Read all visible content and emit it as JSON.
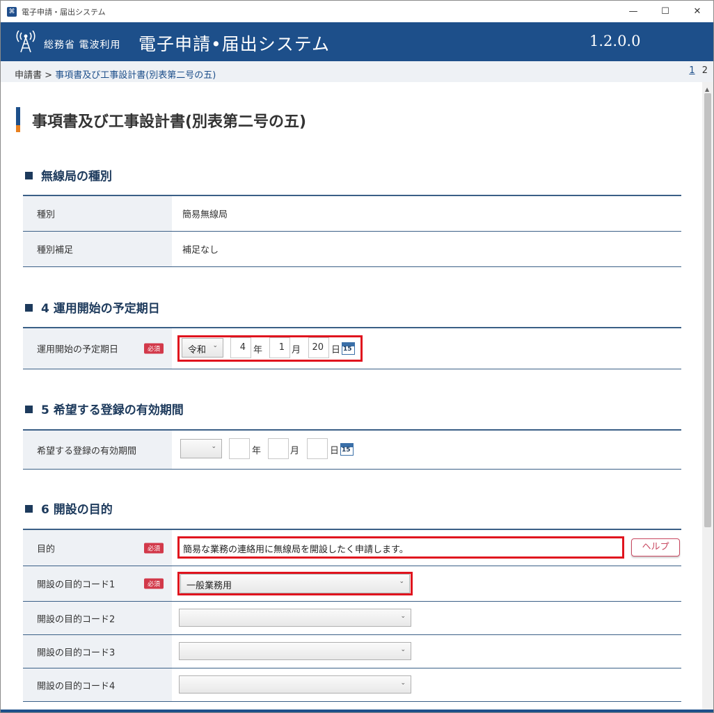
{
  "window": {
    "title": "電子申請・届出システム",
    "minimize": "—",
    "maximize": "☐",
    "close": "✕"
  },
  "header": {
    "org": "総務省 電波利用",
    "system_name": "電子申請•届出システム",
    "version": "1.2.0.0"
  },
  "breadcrumb": {
    "root": "申請書",
    "separator": ">",
    "current": "事項書及び工事設計書(別表第二号の五)",
    "page_current": "1",
    "page_next": "2"
  },
  "page_title": "事項書及び工事設計書(別表第二号の五)",
  "sections": {
    "station_type": {
      "heading": "無線局の種別",
      "rows": [
        {
          "label": "種別",
          "value": "簡易無線局"
        },
        {
          "label": "種別補足",
          "value": "補足なし"
        }
      ]
    },
    "start_date": {
      "heading": "4 運用開始の予定期日",
      "label": "運用開始の予定期日",
      "required": "必須",
      "era": "令和",
      "year": "4",
      "month": "1",
      "day": "20",
      "unit_year": "年",
      "unit_month": "月",
      "unit_day": "日",
      "calendar": "15"
    },
    "validity": {
      "heading": "5 希望する登録の有効期間",
      "label": "希望する登録の有効期間",
      "era": "",
      "year": "",
      "month": "",
      "day": "",
      "unit_year": "年",
      "unit_month": "月",
      "unit_day": "日",
      "calendar": "15"
    },
    "purpose": {
      "heading": "6 開設の目的",
      "purpose_label": "目的",
      "required": "必須",
      "purpose_value": "簡易な業務の連絡用に無線局を開設したく申請します。",
      "help_label": "ヘルプ",
      "code1_label": "開設の目的コード1",
      "code1_value": "一般業務用",
      "code2_label": "開設の目的コード2",
      "code2_value": "",
      "code3_label": "開設の目的コード3",
      "code3_value": "",
      "code4_label": "開設の目的コード4",
      "code4_value": ""
    }
  },
  "icons": {
    "chevron": "⌄",
    "scroll_up": "▲"
  },
  "colors": {
    "brand": "#1d4f8a",
    "accent": "#e8801f",
    "required": "#d2394a",
    "highlight": "#e0141e"
  }
}
